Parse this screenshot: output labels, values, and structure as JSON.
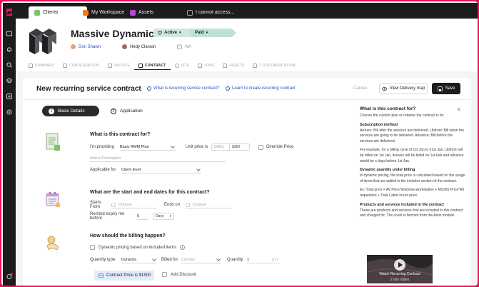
{
  "tabs": [
    {
      "label": "Clients",
      "color": "#7cc46b"
    },
    {
      "label": "My Workspace",
      "color": "#f07a1a"
    },
    {
      "label": "Assets",
      "color": "#b04ad6"
    },
    {
      "label": "I cannot access...",
      "color": "#6d6d74"
    }
  ],
  "client": {
    "name": "Massive Dynamic",
    "status_active": "Active",
    "status_paid": "Paid",
    "owner": "Don Shawn",
    "contact": "Hedy Clarson",
    "date": "NA"
  },
  "subtabs": [
    "SUMMARY",
    "CONVERSATION",
    "INVOICE",
    "CONTRACT",
    "SITE",
    "JOBS",
    "ASSETS",
    "1 DOCUMENTATION"
  ],
  "contract": {
    "title": "New recurring service contract",
    "help_link1": "What is recurring service contract?",
    "help_link2": "Learn to create recurring contract",
    "cancel": "Cancel",
    "view_map": "View Delivery map",
    "save": "Save",
    "steps": [
      {
        "num": "1",
        "label": "Basic Details"
      },
      {
        "num": "2",
        "label": "Application"
      }
    ],
    "section1": {
      "title": "What is this contract for?",
      "providing_label": "I'm providing",
      "providing_value": "Basic RMM Plan",
      "unit_price_label": "Unit price is",
      "currency": "DAEU",
      "amount": "$360",
      "override": "Override Price",
      "description_placeholder": "Add a Description",
      "applicable_label": "Applicable for",
      "applicable_value": "Client level"
    },
    "section2": {
      "title": "What are the start and end dates for this contract?",
      "starts_label": "Starts From",
      "starts_placeholder": "Choose",
      "ends_label": "Ends on",
      "ends_placeholder": "Choose",
      "remind_label": "Remind expiry me before",
      "remind_value": "0",
      "remind_unit": "Days"
    },
    "section3": {
      "title": "How should the billing happen?",
      "dynamic_label": "Dynamic pricing based on included items",
      "quantity_type_label": "Quantity type",
      "quantity_type_value": "Dynamic",
      "billed_for_label": "Billed for",
      "billed_for_placeholder": "Choose",
      "quantity_label": "Quantity",
      "quantity_value": "1",
      "quantity_unit": "QTY",
      "contract_price": "Contract Price is $1500",
      "add_discount": "Add Discount"
    }
  },
  "help_panel": {
    "title": "What is this contract for?",
    "intro": "Choose the custom plan or retainer the contract is for",
    "sub1": "Subscription method",
    "p1": "Arrears: Bill after the services are delivered. Upfront: Bill when the services are going to be delivered. Advance: Bill before the services are delivered.",
    "p2": "For example, for a billing cycle of 1st Jan to 31st Jan, Upfront will be billed on 1st Jan, Arrears will be billed on 1st Feb and advance would be x days before 1st Jan.",
    "sub2": "Dynamic quantity under billing",
    "p3": "In dynamic pricing, the total price is calculated based on the usage of items that are added in the includes section of the contract.",
    "p4": "Ex: Total price = AV Price*windows-workstation + MS365 Price*All requesters + Total Labor hours price.",
    "sub3": "Products and services included in the contract",
    "p5": "These are products and services that are included in this contract and charged for. The count is fetched from the Asbs module.",
    "video_title": "Watch Recurring Contract",
    "video_duration": "2 min Video"
  }
}
